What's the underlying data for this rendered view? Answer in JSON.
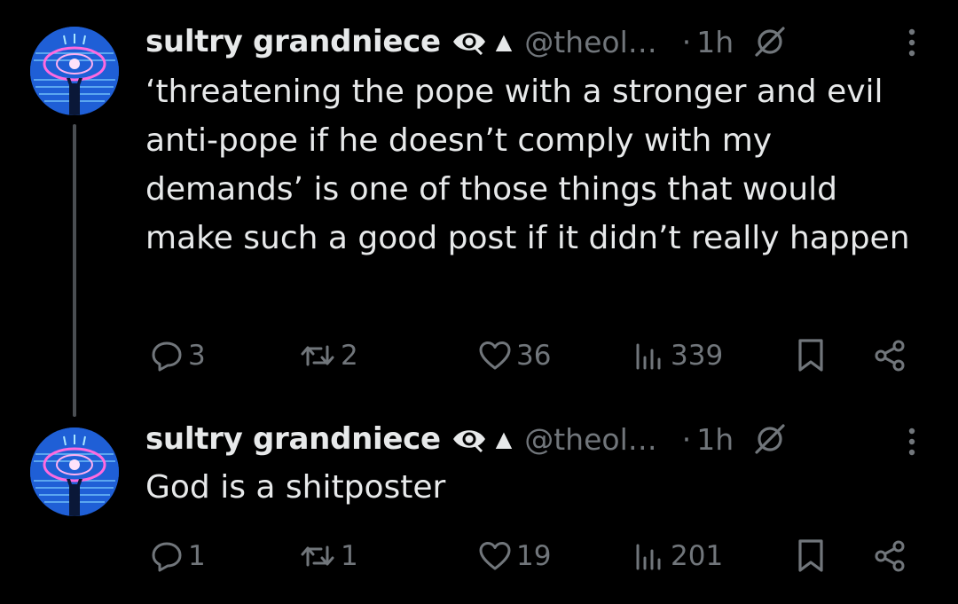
{
  "colors": {
    "background": "#000000",
    "text_primary": "#e7e9ea",
    "text_secondary": "#71767b",
    "thread_line": "#4a4e52",
    "avatar_blue": "#1f5fd6"
  },
  "posts": [
    {
      "author": {
        "display_name": "sultry grandniece",
        "handle": "@theol…",
        "badge_symbol": "▲"
      },
      "separator": "·",
      "time": "1h",
      "text": "‘threatening the pope with a stronger and evil anti-pope if he doesn’t comply with my demands’ is one of those things that would make such a good post if it didn’t really happen",
      "stats": {
        "replies": "3",
        "reposts": "2",
        "likes": "36",
        "views": "339"
      },
      "icons": [
        "avatar",
        "eye-icon",
        "null-icon",
        "more-icon",
        "reply-icon",
        "repost-icon",
        "like-icon",
        "views-icon",
        "bookmark-icon",
        "share-icon"
      ]
    },
    {
      "author": {
        "display_name": "sultry grandniece",
        "handle": "@theol…",
        "badge_symbol": "▲"
      },
      "separator": "·",
      "time": "1h",
      "text": "God is a shitposter",
      "stats": {
        "replies": "1",
        "reposts": "1",
        "likes": "19",
        "views": "201"
      },
      "icons": [
        "avatar",
        "eye-icon",
        "null-icon",
        "more-icon",
        "reply-icon",
        "repost-icon",
        "like-icon",
        "views-icon",
        "bookmark-icon",
        "share-icon"
      ]
    }
  ]
}
